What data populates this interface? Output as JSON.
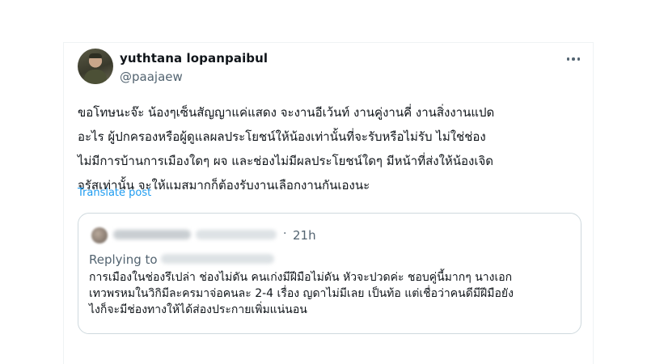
{
  "author": {
    "display_name": "yuthtana lopanpaibul",
    "handle": "@paajaew"
  },
  "post": {
    "lines": [
      "ขอโทษนะจ๊ะ น้องๆเซ็นสัญญาแค่แสดง จะงานอีเว้นท์ งานคู่งานคี่ งานสิ่งงานแปด",
      "อะไร ผู้ปกครองหรือผู้ดูแลผลประโยชน์ให้น้องเท่านั้นที่จะรับหรือไม่รับ ไม่ใช่ช่อง",
      "ไม่มีการบ้านการเมืองใดๆ ผจ และช่องไม่มีผลประโยชน์ใดๆ มีหน้าที่ส่งให้น้องเจิด",
      "จรัสเท่านั้น จะให้แมสมากก็ต้องรับงานเลือกงานกันเองนะ"
    ],
    "translate_label": "Translate post"
  },
  "quoted": {
    "separator": "·",
    "time": "21h",
    "replying_label": "Replying to",
    "lines": [
      "การเมืองในช่องรึเปล่า ช่องไม่ดัน คนเก่งมีฝีมือไม่ดัน หัวจะปวดค่ะ ชอบคู่นี้มากๆ นางเอก",
      "เทวพรหมในวิกิมีละครมาจ่อคนละ 2-4 เรื่อง ญดาไม่มีเลย เป็นท้อ แต่เชื่อว่าคนดีมีฝีมือยัง",
      "ไงก็จะมีช่องทางให้ได้ส่องประกายเพิ่มแน่นอน"
    ]
  },
  "icons": {
    "more": "more-horizontal-icon"
  },
  "colors": {
    "text": "#0f1419",
    "secondary": "#536471",
    "link": "#1d9bf0",
    "border": "#cfd9de"
  }
}
